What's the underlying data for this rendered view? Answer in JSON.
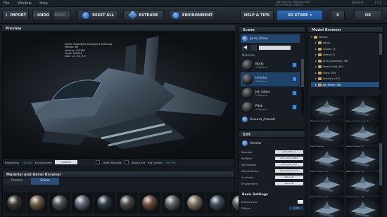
{
  "menu": {
    "items": [
      "File",
      "Window",
      "Help"
    ],
    "gpu": "GeForce GTX 580/PCIe/SSE2",
    "gpu_sub": "803 1396 VB 1GB/PE4",
    "element_label": "Element",
    "version": "1.0.2"
  },
  "toolbar": {
    "import": "IMPORT",
    "undo": "UNDO",
    "redo": "REDO",
    "reset_all": "RESET ALL",
    "extrude": "EXTRUDE",
    "environment": "ENVIRONMENT",
    "help_tips": "HELP & TIPS",
    "store": "3D STORE",
    "close": "X",
    "ok": "OK"
  },
  "preview": {
    "title": "Preview",
    "info": [
      "Model: Models/Jet_Strike/joint_strike.obj",
      "Meshes: 89",
      "Vertices: 113330",
      "Faces: 103914",
      "Size: 1.4, 0.4, 3.0"
    ],
    "brightness_label": "Brightness",
    "brightness_value": "100.0%",
    "environment_label": "Environment",
    "environment_value": "Cinema",
    "draft_label": "Draft Textures",
    "grid_label": "Show Grid",
    "rig_label": "Rig Control",
    "rig_value": "100.0%"
  },
  "material_browser": {
    "title": "Material and Bevel Browser",
    "tabs": [
      "Presets",
      "Scene"
    ],
    "swatches": [
      "#3a3530",
      "#6b5a44",
      "#4a4f55",
      "#5b6675",
      "#2f3945",
      "#454545",
      "#6a4a3a",
      "#5a5f63",
      "#7a6d5d",
      "#3c4c5c",
      "#545a60"
    ]
  },
  "scene": {
    "title": "Scene",
    "object": "Joint_Strike",
    "materials_label": "Materials",
    "materials": [
      {
        "name": "Body",
        "sub": "4 Textures",
        "selected": false
      },
      {
        "name": "Interior",
        "sub": "4 Textures",
        "selected": true
      },
      {
        "name": "Jet_Glass",
        "sub": "2 Textures",
        "selected": false
      },
      {
        "name": "Pilot",
        "sub": "4 Textures",
        "selected": false
      }
    ],
    "object2": "Ground_Assault"
  },
  "edit": {
    "title": "Edit",
    "material": "Interior",
    "rows": [
      {
        "label": "Specular",
        "value": "joint_strike_s"
      },
      {
        "label": "Refl/Refr",
        "value": "joint_strike_reflect"
      },
      {
        "label": "Illumination",
        "value": "joint_strike_illum"
      },
      {
        "label": "Normal Bump",
        "value": "joint_strike_normal"
      },
      {
        "label": "Occlusion",
        "value": "None Set"
      },
      {
        "label": "Environment",
        "value": "None Set"
      }
    ],
    "basic_label": "Basic Settings",
    "diffuse_color_label": "Diffuse Color",
    "diffuse_label": "Diffuse",
    "diffuse_value": "1.00"
  },
  "model_browser": {
    "title": "Model Browser",
    "tree": [
      {
        "label": "Models",
        "depth": 0,
        "selected": false
      },
      {
        "label": "bases",
        "depth": 1,
        "selected": false
      },
      {
        "label": "Clouds (1)",
        "depth": 1,
        "selected": false
      },
      {
        "label": "Demo (3)",
        "depth": 1,
        "selected": false
      },
      {
        "label": "Euro_Buildings (36)",
        "depth": 1,
        "selected": false
      },
      {
        "label": "Fresh_Food (82)",
        "depth": 1,
        "selected": false
      },
      {
        "label": "Icons (30)",
        "depth": 1,
        "selected": false
      },
      {
        "label": "Industry (42)",
        "depth": 1,
        "selected": false
      },
      {
        "label": "Jet_Strike (38)",
        "depth": 1,
        "selected": true
      }
    ],
    "thumbs": [
      "Ground_Assault",
      "Ground_Assault_02",
      "Joint_Strike",
      "Joint_Strike_02",
      "Joint_Strike_03",
      "Joint_Strike_04",
      "Joint_Strike_05",
      "Joint_Strike_06",
      "Jumbo_Jet",
      "Jumbo_Jet_02"
    ]
  },
  "colors": {
    "accent": "#2f6fb8",
    "selection": "#23507f",
    "background": "#151a20"
  }
}
